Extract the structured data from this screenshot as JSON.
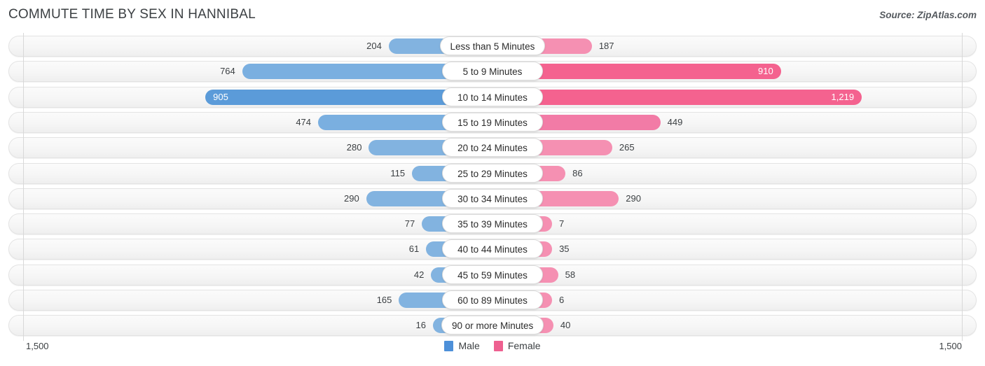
{
  "header": {
    "title": "COMMUTE TIME BY SEX IN HANNIBAL",
    "source": "Source: ZipAtlas.com"
  },
  "legend": {
    "male_label": "Male",
    "female_label": "Female",
    "male_color": "#4d90d9",
    "female_color": "#ee6090"
  },
  "axis": {
    "left_tick": "1,500",
    "right_tick": "1,500",
    "max": 1500
  },
  "chart_data": {
    "type": "bar",
    "title": "COMMUTE TIME BY SEX IN HANNIBAL",
    "orientation": "horizontal-diverging",
    "xlabel": "",
    "ylabel": "",
    "xlim": [
      1500,
      1500
    ],
    "grid": false,
    "legend_position": "bottom-center",
    "categories": [
      "Less than 5 Minutes",
      "5 to 9 Minutes",
      "10 to 14 Minutes",
      "15 to 19 Minutes",
      "20 to 24 Minutes",
      "25 to 29 Minutes",
      "30 to 34 Minutes",
      "35 to 39 Minutes",
      "40 to 44 Minutes",
      "45 to 59 Minutes",
      "60 to 89 Minutes",
      "90 or more Minutes"
    ],
    "series": [
      {
        "name": "Male",
        "color": "#4d90d9",
        "values": [
          204,
          764,
          905,
          474,
          280,
          115,
          290,
          77,
          61,
          42,
          165,
          16
        ],
        "labels": [
          "204",
          "764",
          "905",
          "474",
          "280",
          "115",
          "290",
          "77",
          "61",
          "42",
          "165",
          "16"
        ]
      },
      {
        "name": "Female",
        "color": "#ee6090",
        "values": [
          187,
          910,
          1219,
          449,
          265,
          86,
          290,
          7,
          35,
          58,
          6,
          40
        ],
        "labels": [
          "187",
          "910",
          "1,219",
          "449",
          "265",
          "86",
          "290",
          "7",
          "35",
          "58",
          "6",
          "40"
        ]
      }
    ]
  }
}
